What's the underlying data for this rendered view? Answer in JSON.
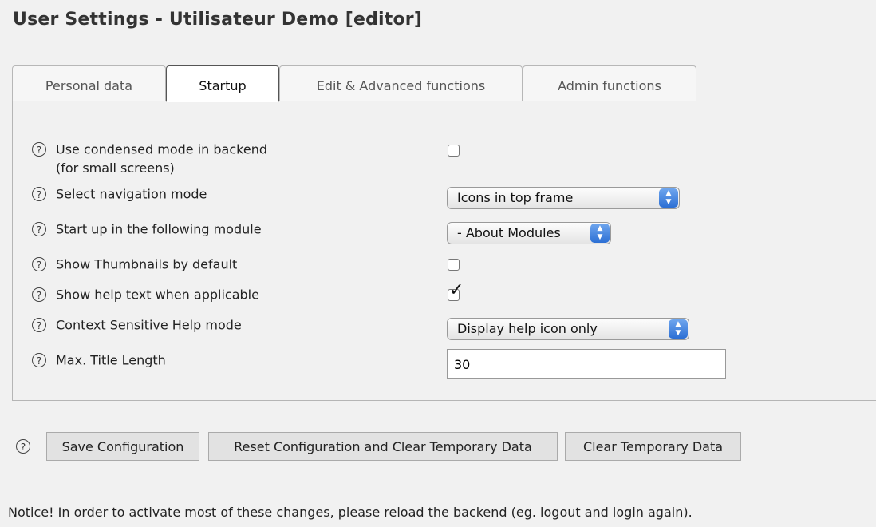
{
  "page": {
    "title": "User Settings - Utilisateur Demo [editor]"
  },
  "tabs": [
    {
      "label": "Personal data"
    },
    {
      "label": "Startup"
    },
    {
      "label": "Edit & Advanced functions"
    },
    {
      "label": "Admin functions"
    }
  ],
  "active_tab": "Startup",
  "help_glyph": "?",
  "settings": {
    "condensed_mode": {
      "label_line1": "Use condensed mode in backend",
      "label_line2": "(for small screens)",
      "checked": false
    },
    "navigation_mode": {
      "label": "Select navigation mode",
      "value": "Icons in top frame"
    },
    "startup_module": {
      "label": "Start up in the following module",
      "value": "- About Modules"
    },
    "show_thumbnails": {
      "label": "Show Thumbnails by default",
      "checked": false
    },
    "show_help_text": {
      "label": "Show help text when applicable",
      "checked": true
    },
    "csh_mode": {
      "label": "Context Sensitive Help mode",
      "value": "Display help icon only"
    },
    "max_title_length": {
      "label": "Max. Title Length",
      "value": "30"
    }
  },
  "buttons": {
    "save": "Save Configuration",
    "reset": "Reset Configuration and Clear Temporary Data",
    "clear": "Clear Temporary Data"
  },
  "notice": "Notice! In order to activate most of these changes, please reload the backend (eg. logout and login again).",
  "icons": {
    "help": "help-circle-icon",
    "select_arrows": "up-down-arrows-icon",
    "check": "checkmark-icon"
  }
}
